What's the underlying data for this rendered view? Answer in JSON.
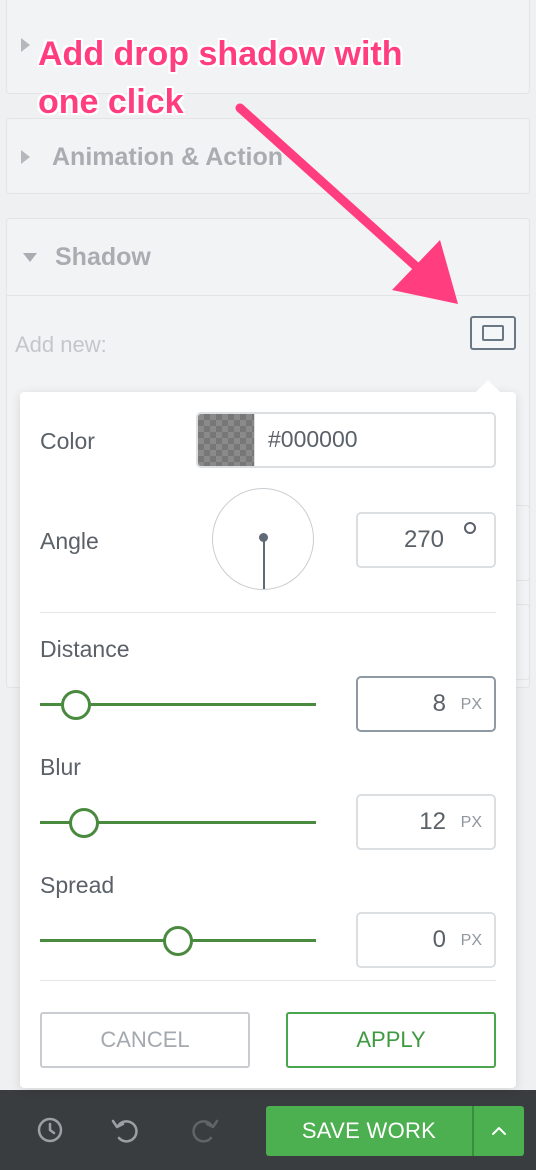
{
  "annotation": {
    "text": "Add drop shadow with one click"
  },
  "sections": {
    "top_partial": {
      "label": ""
    },
    "animation": {
      "label": "Animation & Action"
    },
    "shadow": {
      "label": "Shadow"
    }
  },
  "add_new": {
    "label": "Add new:"
  },
  "shadow_popover": {
    "color": {
      "label": "Color",
      "value": "#000000"
    },
    "angle": {
      "label": "Angle",
      "value": "270"
    },
    "distance": {
      "label": "Distance",
      "value": "8",
      "unit": "PX",
      "slider_fraction": 0.13
    },
    "blur": {
      "label": "Blur",
      "value": "12",
      "unit": "PX",
      "slider_fraction": 0.16
    },
    "spread": {
      "label": "Spread",
      "value": "0",
      "unit": "PX",
      "slider_fraction": 0.5
    },
    "cancel_label": "CANCEL",
    "apply_label": "APPLY"
  },
  "bottom_bar": {
    "save_label": "SAVE WORK",
    "icons": [
      "history-icon",
      "undo-icon",
      "redo-icon",
      "chevron-up-icon"
    ]
  },
  "colors": {
    "accent_green": "#4caf50",
    "annotation_pink": "#ff3d7f",
    "bottom_bar": "#3a3d40"
  }
}
